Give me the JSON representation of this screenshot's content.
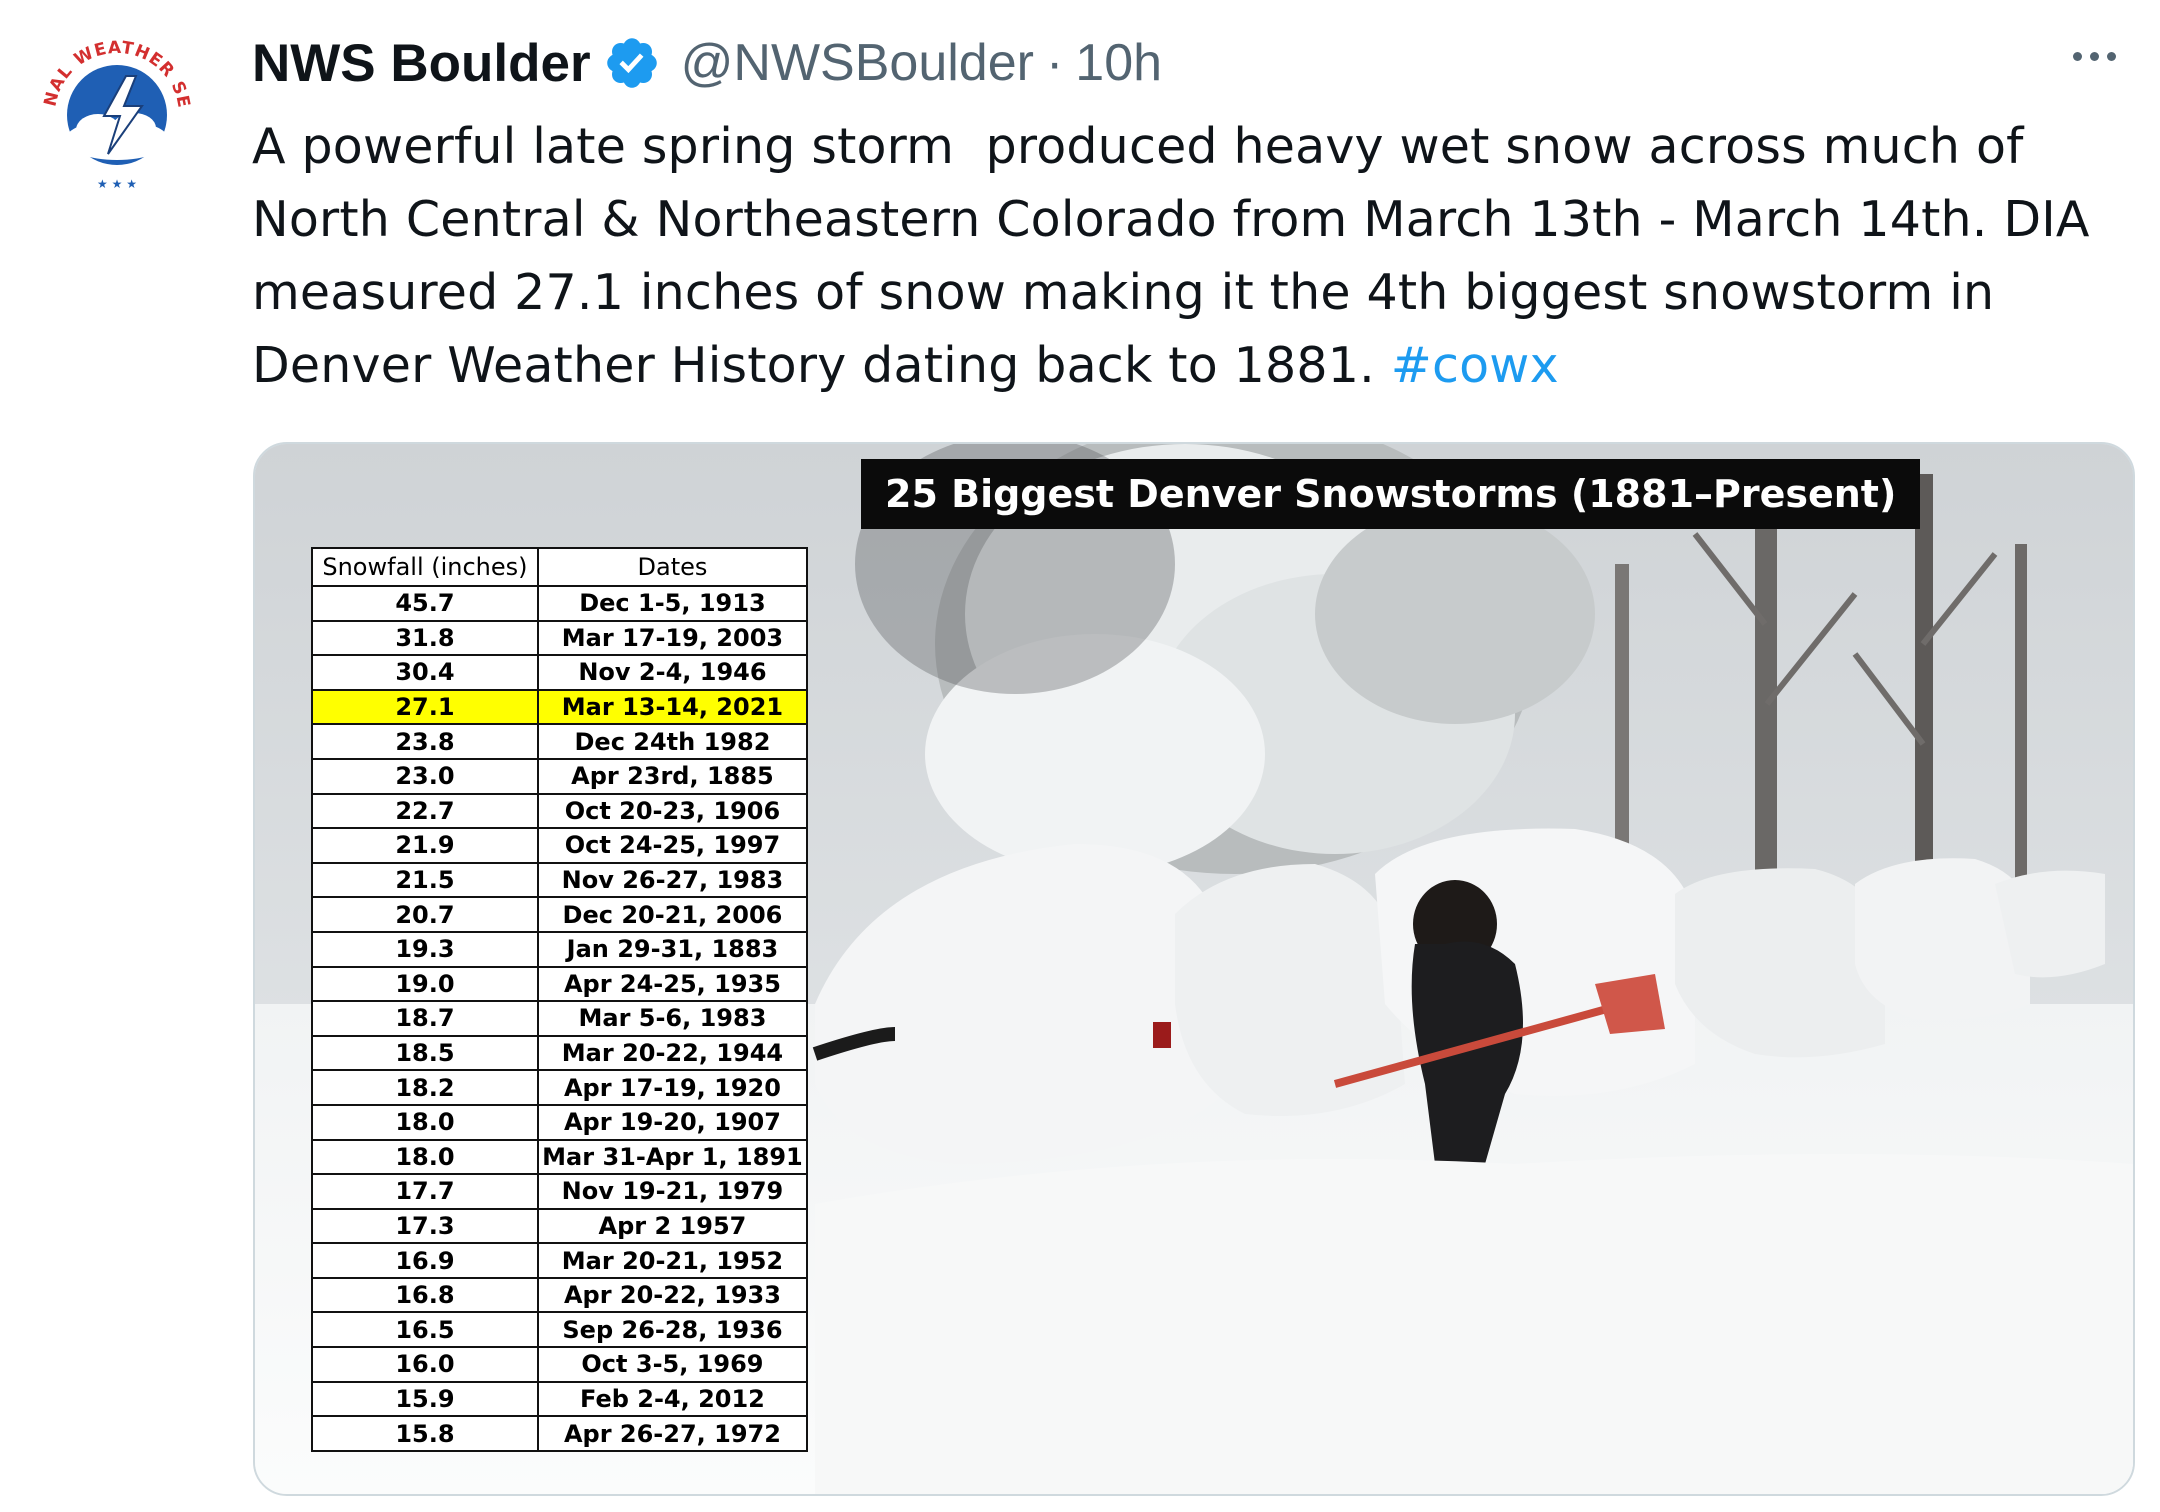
{
  "tweet": {
    "author": {
      "display_name": "NWS Boulder",
      "handle": "@NWSBoulder",
      "verified": true,
      "avatar_icon": "nws-logo-icon"
    },
    "separator": "·",
    "timestamp": "10h",
    "more_icon": "more-dots-icon",
    "text_lines": [
      "A powerful late spring storm  produced heavy wet snow across much of",
      "North Central & Northeastern Colorado from March 13th - March 14th. DIA",
      "measured 27.1 inches of snow making it the 4th biggest snowstorm in",
      "Denver Weather History dating back to 1881. "
    ],
    "hashtag": "#cowx",
    "colors": {
      "link": "#1d9bf0",
      "secondary_text": "#536471",
      "verified": "#1d9bf0"
    }
  },
  "media": {
    "title": "25 Biggest Denver Snowstorms (1881–Present)",
    "table": {
      "headers": [
        "Snowfall (inches)",
        "Dates"
      ],
      "highlight_color": "#ffff00",
      "rows": [
        {
          "snowfall": "45.7",
          "dates": "Dec 1-5, 1913"
        },
        {
          "snowfall": "31.8",
          "dates": "Mar 17-19, 2003"
        },
        {
          "snowfall": "30.4",
          "dates": "Nov 2-4, 1946"
        },
        {
          "snowfall": "27.1",
          "dates": "Mar 13-14, 2021",
          "highlight": true
        },
        {
          "snowfall": "23.8",
          "dates": "Dec 24th 1982"
        },
        {
          "snowfall": "23.0",
          "dates": "Apr 23rd, 1885"
        },
        {
          "snowfall": "22.7",
          "dates": "Oct 20-23, 1906"
        },
        {
          "snowfall": "21.9",
          "dates": "Oct 24-25, 1997"
        },
        {
          "snowfall": "21.5",
          "dates": "Nov 26-27, 1983"
        },
        {
          "snowfall": "20.7",
          "dates": "Dec 20-21, 2006"
        },
        {
          "snowfall": "19.3",
          "dates": "Jan  29-31, 1883"
        },
        {
          "snowfall": "19.0",
          "dates": "Apr 24-25, 1935"
        },
        {
          "snowfall": "18.7",
          "dates": "Mar 5-6, 1983"
        },
        {
          "snowfall": "18.5",
          "dates": "Mar 20-22, 1944"
        },
        {
          "snowfall": "18.2",
          "dates": "Apr 17-19, 1920"
        },
        {
          "snowfall": "18.0",
          "dates": "Apr 19-20, 1907"
        },
        {
          "snowfall": "18.0",
          "dates": "Mar 31-Apr 1, 1891"
        },
        {
          "snowfall": "17.7",
          "dates": "Nov 19-21, 1979"
        },
        {
          "snowfall": "17.3",
          "dates": "Apr 2 1957"
        },
        {
          "snowfall": "16.9",
          "dates": "Mar 20-21, 1952"
        },
        {
          "snowfall": "16.8",
          "dates": "Apr 20-22, 1933"
        },
        {
          "snowfall": "16.5",
          "dates": "Sep 26-28, 1936"
        },
        {
          "snowfall": "16.0",
          "dates": "Oct 3-5, 1969"
        },
        {
          "snowfall": "15.9",
          "dates": "Feb 2-4, 2012"
        },
        {
          "snowfall": "15.8",
          "dates": "Apr 26-27, 1972"
        }
      ]
    }
  }
}
